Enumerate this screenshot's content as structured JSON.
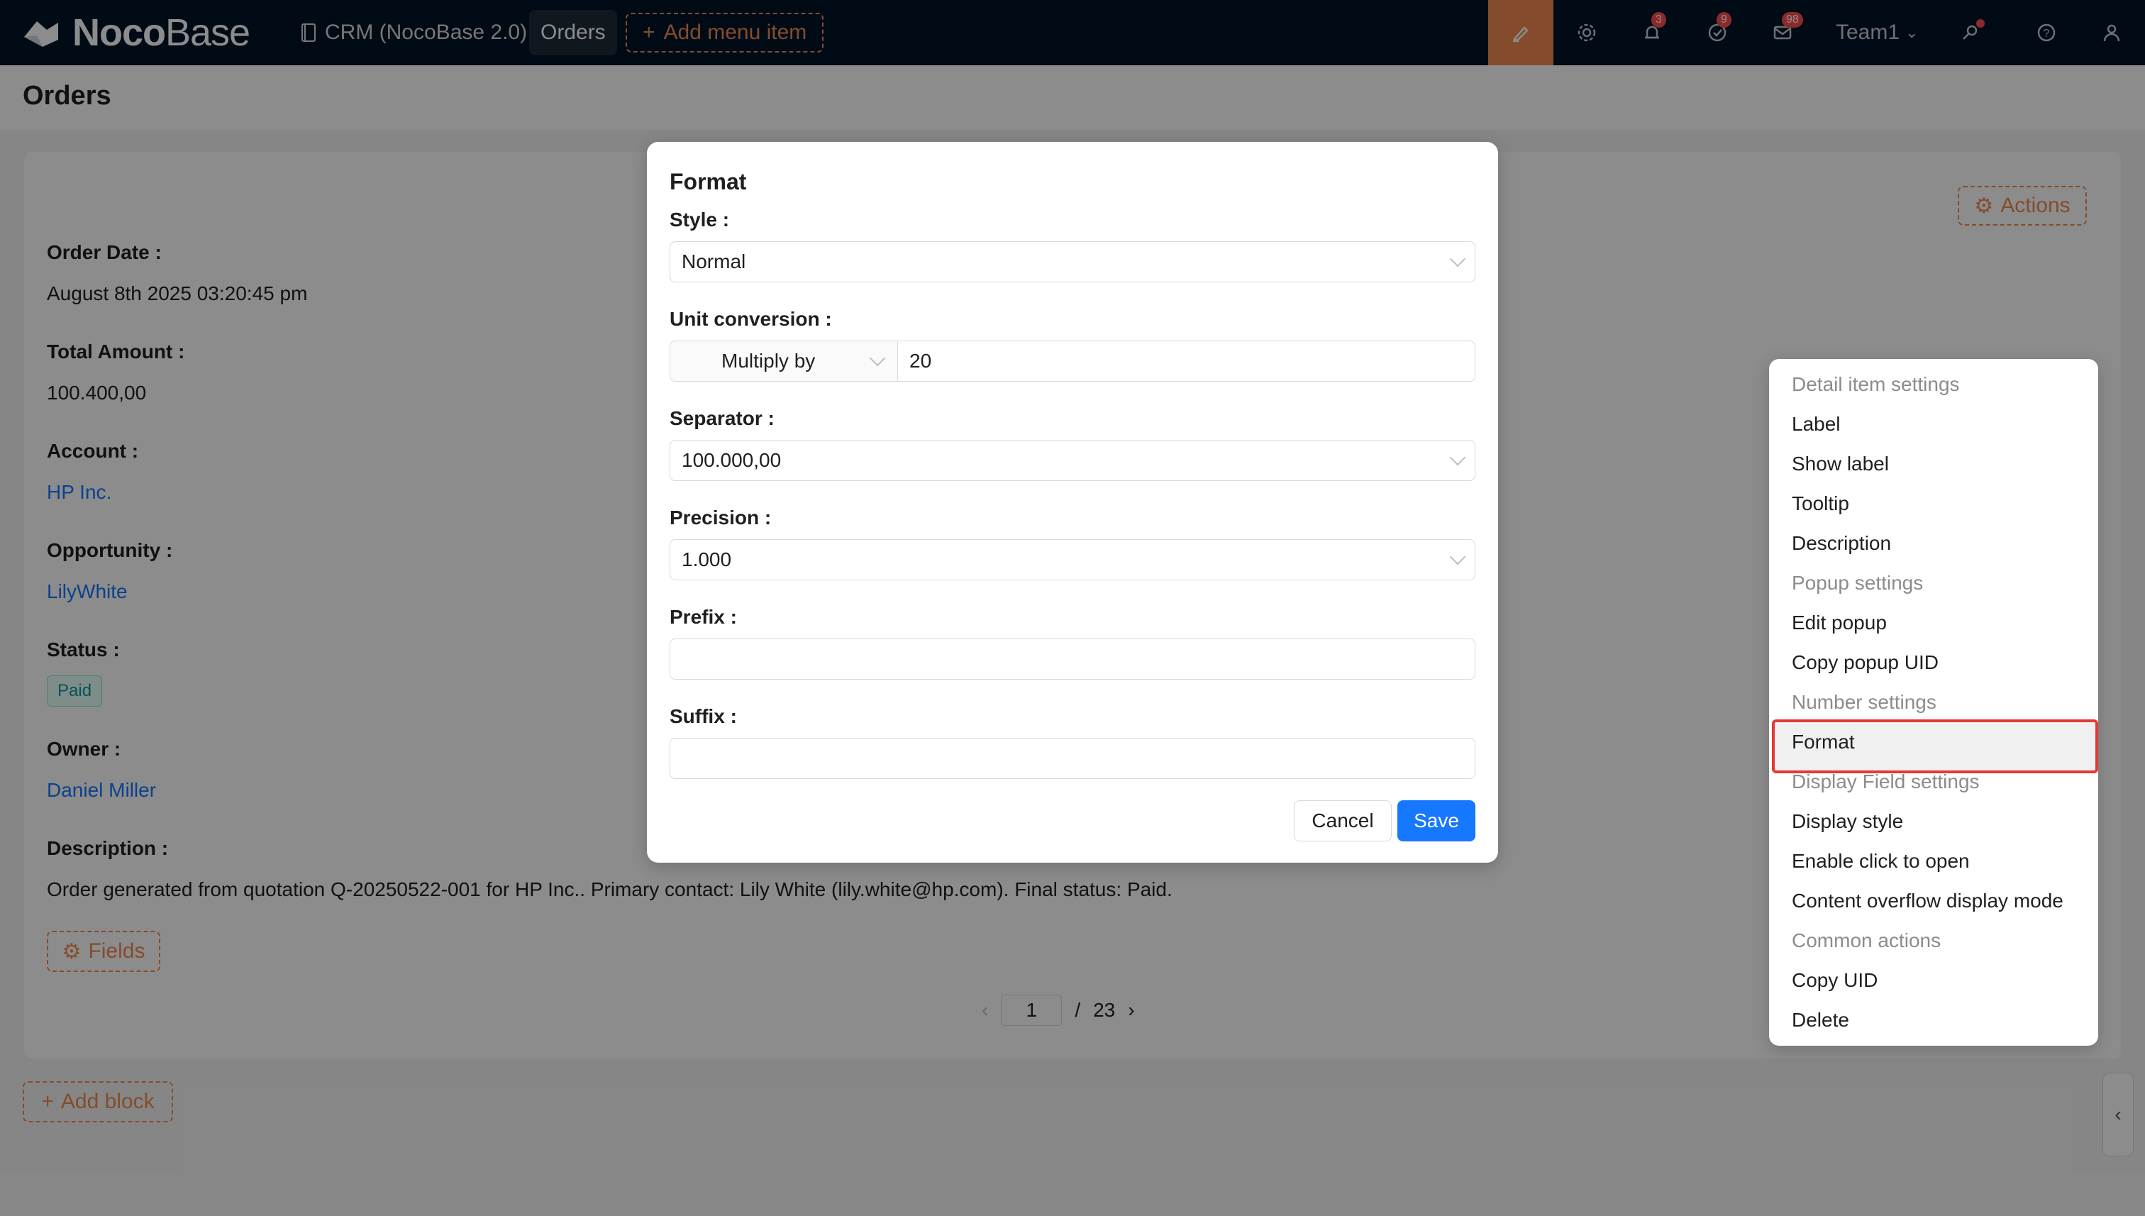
{
  "app": {
    "brand_bold": "Noco",
    "brand_thin": "Base"
  },
  "nav": {
    "crm": "CRM (NocoBase 2.0)",
    "orders": "Orders",
    "add_menu_item": "Add menu item"
  },
  "topbar": {
    "notifications_badge": "3",
    "tasks_badge": "9",
    "messages_badge": "98",
    "team": "Team1"
  },
  "page": {
    "title": "Orders"
  },
  "details": {
    "actions_label": "Actions",
    "fields": [
      {
        "label": "Order Date :",
        "value": "August 8th 2025 03:20:45 pm"
      },
      {
        "label": "Total Amount :",
        "value": "100.400,00"
      },
      {
        "label": "Account :",
        "value": "HP Inc."
      },
      {
        "label": "Opportunity :",
        "value": "LilyWhite"
      },
      {
        "label": "Status :",
        "value": "Paid"
      },
      {
        "label": "Owner :",
        "value": "Daniel Miller"
      },
      {
        "label": "Description :",
        "value": "Order generated from quotation Q-20250522-001 for HP Inc.. Primary contact: Lily White (lily.white@hp.com). Final status: Paid."
      }
    ],
    "fields_button": "Fields",
    "pager": {
      "current": "1",
      "separator": "/",
      "total": "23"
    },
    "add_block": "Add block"
  },
  "format_modal": {
    "title": "Format",
    "style_label": "Style",
    "style_value": "Normal",
    "unit_label": "Unit conversion",
    "unit_operator": "Multiply by",
    "unit_value": "20",
    "separator_label": "Separator",
    "separator_value": "100.000,00",
    "precision_label": "Precision",
    "precision_value": "1.000",
    "prefix_label": "Prefix",
    "prefix_value": "",
    "suffix_label": "Suffix",
    "suffix_value": "",
    "cancel": "Cancel",
    "save": "Save",
    "colon": ":"
  },
  "settings_menu": {
    "items": [
      {
        "label": "Detail item settings",
        "group": true
      },
      {
        "label": "Label",
        "group": false
      },
      {
        "label": "Show label",
        "group": false
      },
      {
        "label": "Tooltip",
        "group": false
      },
      {
        "label": "Description",
        "group": false
      },
      {
        "label": "Popup settings",
        "group": true
      },
      {
        "label": "Edit popup",
        "group": false
      },
      {
        "label": "Copy popup UID",
        "group": false
      },
      {
        "label": "Number settings",
        "group": true
      },
      {
        "label": "Format",
        "group": false,
        "selected": true
      },
      {
        "label": "Display Field settings",
        "group": true
      },
      {
        "label": "Display style",
        "group": false
      },
      {
        "label": "Enable click to open",
        "group": false
      },
      {
        "label": "Content overflow display mode",
        "group": false
      },
      {
        "label": "Common actions",
        "group": true
      },
      {
        "label": "Copy UID",
        "group": false
      },
      {
        "label": "Delete",
        "group": false
      }
    ]
  },
  "colors": {
    "accent": "#f18b52",
    "primary": "#1677ff",
    "topbar": "#001529",
    "highlight_border": "#e53935"
  }
}
